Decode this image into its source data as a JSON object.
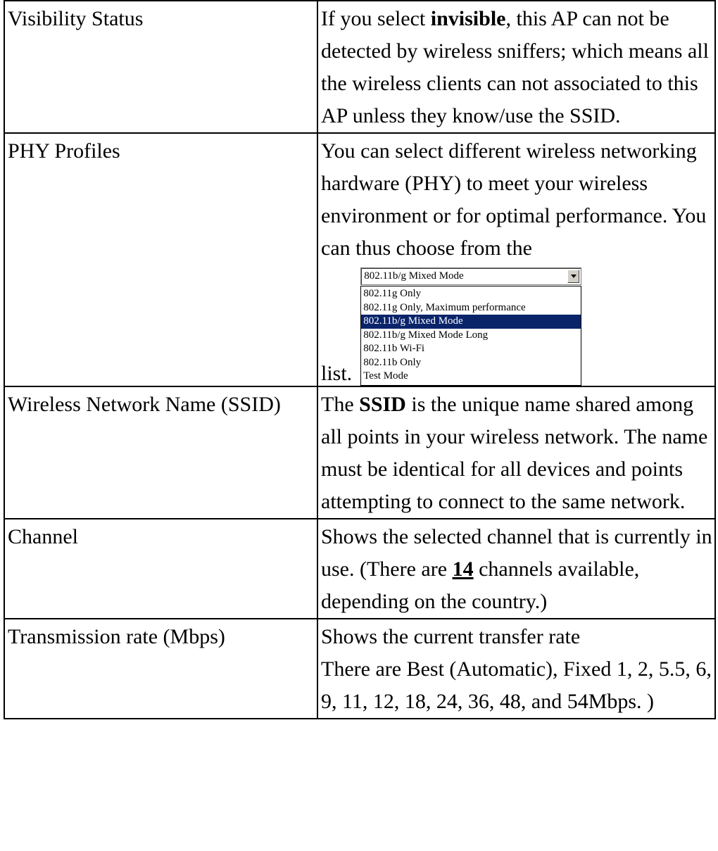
{
  "rows": [
    {
      "label": "Visibility Status",
      "desc": [
        {
          "t": "If you select "
        },
        {
          "t": "invisible",
          "b": true
        },
        {
          "t": ", this AP can not be detected by wireless sniffers; which means all the wireless clients can not associated to this AP unless they know/use the SSID."
        }
      ]
    },
    {
      "label": "PHY Profiles",
      "desc": [
        {
          "t": "You can select different wireless networking hardware (PHY) to meet your wireless environment or for optimal performance. You can thus choose from the"
        }
      ],
      "list_word": "list.",
      "phy_select": {
        "selected": "802.11b/g Mixed Mode",
        "options": [
          "802.11g Only",
          "802.11g Only, Maximum performance",
          "802.11b/g Mixed Mode",
          "802.11b/g Mixed Mode Long",
          "802.11b Wi-Fi",
          "802.11b Only",
          "Test Mode"
        ],
        "highlighted_index": 2,
        "highlight_color": "#0a246a"
      }
    },
    {
      "label": "Wireless Network Name (SSID)",
      "desc": [
        {
          "t": "The "
        },
        {
          "t": "SSID",
          "b": true
        },
        {
          "t": " is the unique name shared among all points in your wireless network. The name must be identical for all devices and points attempting to connect to the same network."
        }
      ]
    },
    {
      "label": "Channel",
      "desc": [
        {
          "t": "Shows the selected channel that is currently in use. (There are "
        },
        {
          "t": "14",
          "u": true
        },
        {
          "t": " channels available, depending on the country.)"
        }
      ]
    },
    {
      "label": "Transmission rate (Mbps)",
      "desc": [
        {
          "t": "Shows the current transfer rate"
        },
        {
          "br": true
        },
        {
          "t": "There are Best (Automatic), Fixed 1, 2, 5.5, 6, 9, 11, 12, 18, 24, 36, 48, and 54Mbps. )"
        }
      ]
    }
  ]
}
